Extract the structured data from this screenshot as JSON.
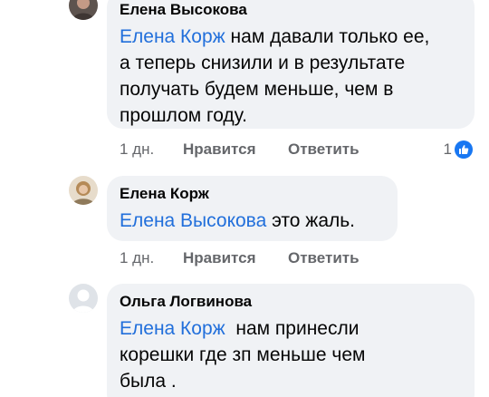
{
  "comments": [
    {
      "author": "Елена Высокова",
      "mention": "Елена Корж",
      "text_line1": " нам давали только ее,",
      "text_rest": "а теперь снизили и в результате получать будем меньше, чем в прошлом году.",
      "time": "1 дн.",
      "like_label": "Нравится",
      "reply_label": "Ответить",
      "reaction_count": "1",
      "reaction_icon": "like-icon",
      "avatar_color": "#7a6a62"
    },
    {
      "author": "Елена Корж",
      "mention": "Елена Высокова",
      "text": " это жаль.",
      "time": "1 дн.",
      "like_label": "Нравится",
      "reply_label": "Ответить",
      "avatar_color": "#c9a97a"
    },
    {
      "author": "Ольга Логвинова",
      "mention": "Елена Корж",
      "text_line1": "  нам принесли",
      "text_rest": "корешки где зп меньше чем была .",
      "avatar_color": "#dfe3e8"
    }
  ],
  "colors": {
    "mention": "#216fdb",
    "bubble": "#f0f2f5",
    "meta": "#65676b",
    "like_blue": "#1877f2"
  }
}
